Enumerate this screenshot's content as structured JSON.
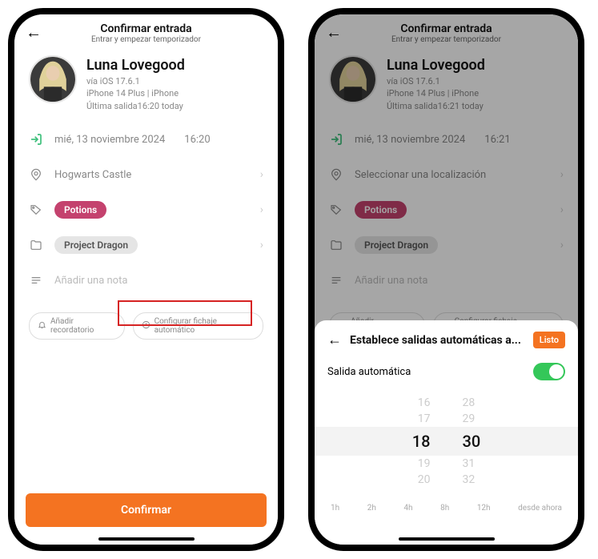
{
  "left": {
    "header": {
      "title": "Confirmar entrada",
      "subtitle": "Entrar y empezar temporizador"
    },
    "user": {
      "name": "Luna Lovegood",
      "os": "vía iOS 17.6.1",
      "device": "iPhone 14 Plus | iPhone",
      "last": "Última salida16:20 today"
    },
    "datetime": {
      "date": "mié, 13 noviembre 2024",
      "time": "16:20"
    },
    "location": "Hogwarts Castle",
    "tag": "Potions",
    "project": "Project Dragon",
    "note_placeholder": "Añadir una nota",
    "chips": {
      "reminder": "Añadir recordatorio",
      "auto": "Configurar fichaje automático"
    },
    "confirm": "Confirmar"
  },
  "right": {
    "header": {
      "title": "Confirmar entrada",
      "subtitle": "Entrar y empezar temporizador"
    },
    "user": {
      "name": "Luna Lovegood",
      "os": "vía iOS 17.6.1",
      "device": "iPhone 14 Plus | iPhone",
      "last": "Última salida16:21 today"
    },
    "datetime": {
      "date": "mié, 13 noviembre 2024",
      "time": "16:21"
    },
    "location": "Seleccionar una localización",
    "tag": "Potions",
    "project": "Project Dragon",
    "note_placeholder": "Añadir una nota",
    "chips": {
      "reminder": "Añadir recordatorio",
      "auto": "Configurar fichaje automático"
    },
    "sheet": {
      "title": "Establece salidas automáticas a...",
      "done": "Listo",
      "toggle_label": "Salida automática",
      "picker": {
        "rows": [
          {
            "h": "16",
            "m": "28"
          },
          {
            "h": "17",
            "m": "29"
          },
          {
            "h": "18",
            "m": "30"
          },
          {
            "h": "19",
            "m": "31"
          },
          {
            "h": "20",
            "m": "32"
          }
        ]
      },
      "quicks": [
        "1h",
        "2h",
        "4h",
        "8h",
        "12h",
        "desde ahora"
      ]
    }
  }
}
